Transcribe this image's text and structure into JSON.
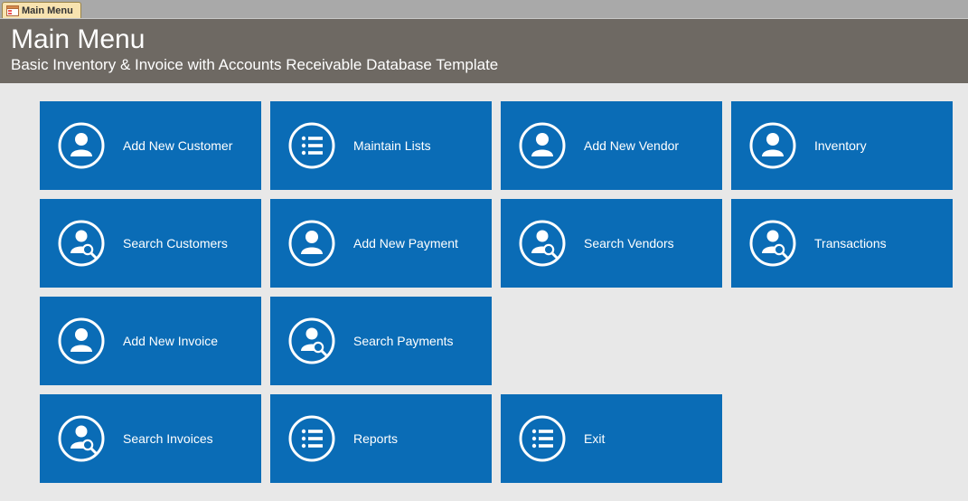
{
  "tab": {
    "label": "Main Menu"
  },
  "header": {
    "title": "Main Menu",
    "subtitle": "Basic Inventory & Invoice with Accounts Receivable Database Template"
  },
  "tiles": {
    "add_new_customer": "Add New Customer",
    "maintain_lists": "Maintain Lists",
    "add_new_vendor": "Add New Vendor",
    "inventory": "Inventory",
    "search_customers": "Search Customers",
    "add_new_payment": "Add New Payment",
    "search_vendors": "Search Vendors",
    "transactions": "Transactions",
    "add_new_invoice": "Add New Invoice",
    "search_payments": "Search Payments",
    "search_invoices": "Search Invoices",
    "reports": "Reports",
    "exit": "Exit"
  }
}
